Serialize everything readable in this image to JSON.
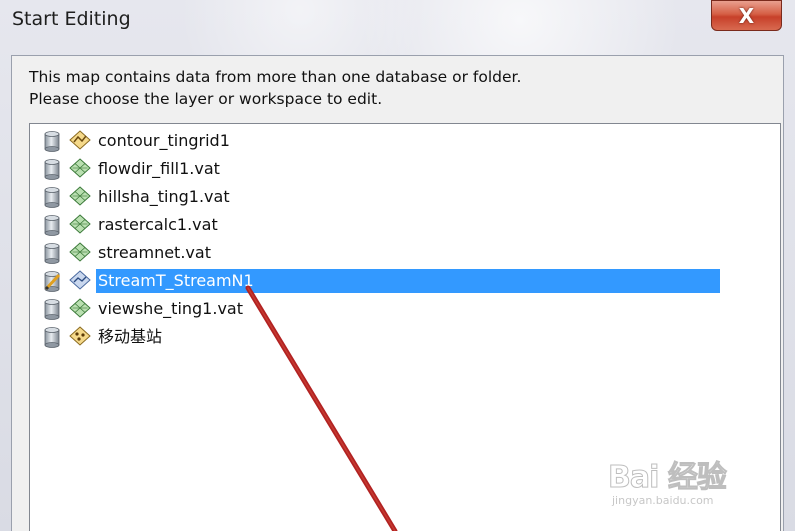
{
  "window": {
    "title": "Start Editing",
    "close_label": "X"
  },
  "instructions": {
    "line1": "This map contains data from more than one database or folder.",
    "line2": "Please choose the layer or workspace to edit."
  },
  "list": {
    "items": [
      {
        "label": "contour_tingrid1",
        "db_icon": "database-icon",
        "layer_icon": "tin-layer-icon",
        "selected": false
      },
      {
        "label": "flowdir_fill1.vat",
        "db_icon": "database-icon",
        "layer_icon": "raster-layer-icon",
        "selected": false
      },
      {
        "label": "hillsha_ting1.vat",
        "db_icon": "database-icon",
        "layer_icon": "raster-layer-icon",
        "selected": false
      },
      {
        "label": "rastercalc1.vat",
        "db_icon": "database-icon",
        "layer_icon": "raster-layer-icon",
        "selected": false
      },
      {
        "label": "streamnet.vat",
        "db_icon": "database-icon",
        "layer_icon": "raster-layer-icon",
        "selected": false
      },
      {
        "label": "StreamT_StreamN1",
        "db_icon": "edit-database-icon",
        "layer_icon": "line-layer-icon",
        "selected": true
      },
      {
        "label": "viewshe_ting1.vat",
        "db_icon": "database-icon",
        "layer_icon": "raster-layer-icon",
        "selected": false
      },
      {
        "label": "移动基站",
        "db_icon": "database-icon",
        "layer_icon": "point-layer-icon",
        "selected": false
      }
    ]
  },
  "watermark": {
    "brand": "Bai 经验",
    "site": "jingyan.baidu.com"
  },
  "colors": {
    "selection": "#3399ff",
    "close_button": "#c7402a",
    "annotation_arrow": "#b22222"
  }
}
